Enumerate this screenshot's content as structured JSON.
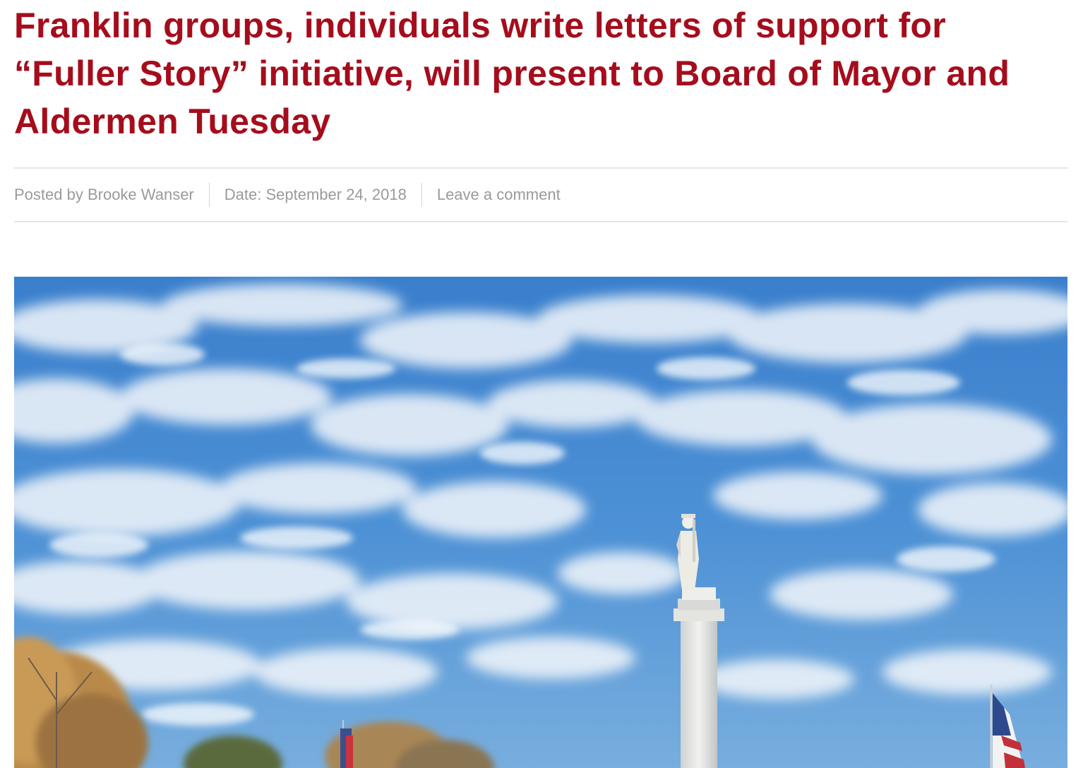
{
  "article": {
    "title": "Franklin groups, individuals write letters of support for “Fuller Story” initiative, will present to Board of Mayor and Aldermen Tuesday",
    "meta": {
      "author": "Posted by Brooke Wanser",
      "date": "Date: September 24, 2018",
      "comment_link": "Leave a comment"
    }
  },
  "colors": {
    "headline": "#a50d1c",
    "meta_text": "#9a9a9a",
    "divider": "#e6e6e6"
  }
}
